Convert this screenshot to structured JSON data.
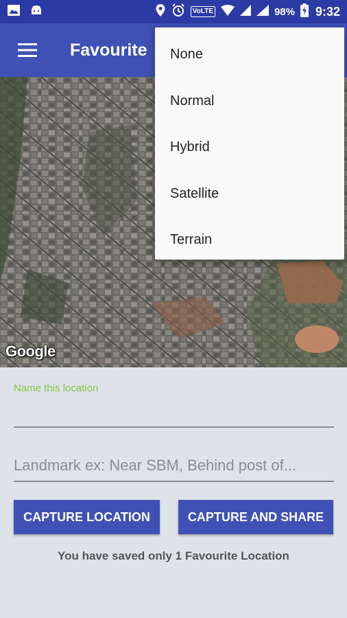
{
  "status_bar": {
    "volte": "VoLTE",
    "battery_pct": "98%",
    "clock": "9:32"
  },
  "app_bar": {
    "title": "Favourite",
    "menu_icon": "hamburger-menu-icon"
  },
  "map": {
    "provider_logo": "Google"
  },
  "map_type_menu": {
    "items": [
      "None",
      "Normal",
      "Hybrid",
      "Satellite",
      "Terrain"
    ]
  },
  "form": {
    "name_label": "Name this location",
    "landmark_placeholder": "Landmark ex: Near SBM, Behind post of...",
    "capture_button": "CAPTURE LOCATION",
    "share_button": "CAPTURE AND SHARE",
    "saved_message": "You have saved only 1 Favourite Location"
  },
  "colors": {
    "status_bar": "#2c3aa6",
    "app_bar": "#3f51b5",
    "accent_green": "#8bc34a",
    "form_bg": "#dde3e8"
  }
}
